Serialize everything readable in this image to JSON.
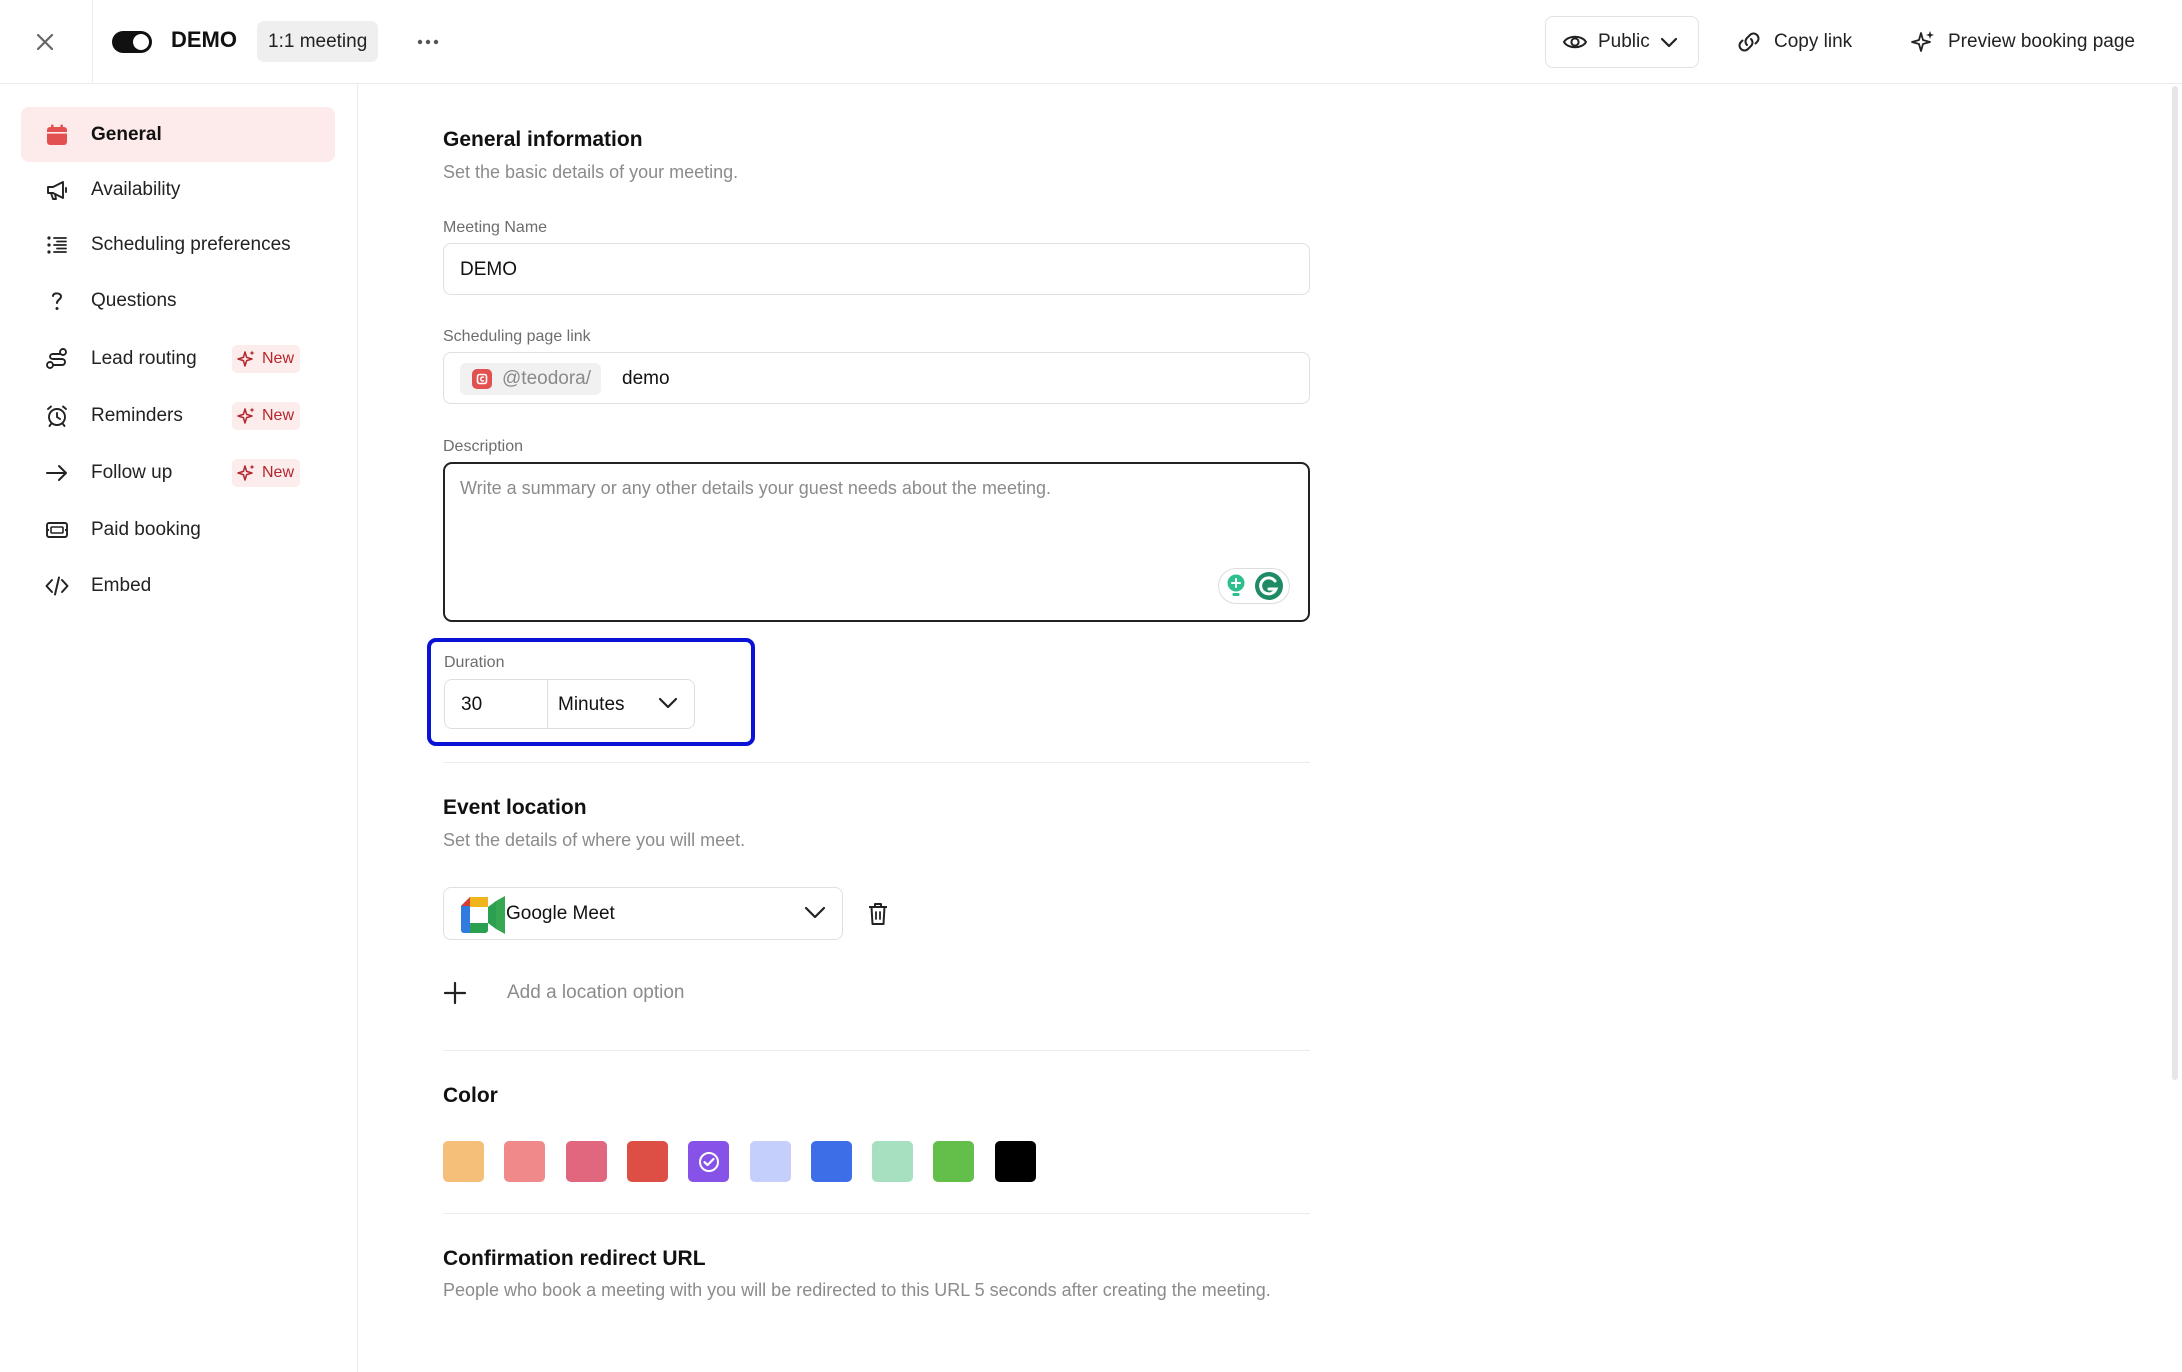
{
  "header": {
    "title": "DEMO",
    "meeting_type": "1:1 meeting",
    "visibility": "Public",
    "copy_link": "Copy link",
    "preview": "Preview booking page"
  },
  "sidebar": {
    "items": [
      {
        "label": "General",
        "icon": "calendar-icon",
        "active": true
      },
      {
        "label": "Availability",
        "icon": "megaphone-icon"
      },
      {
        "label": "Scheduling preferences",
        "icon": "list-icon"
      },
      {
        "label": "Questions",
        "icon": "question-icon"
      },
      {
        "label": "Lead routing",
        "icon": "route-icon",
        "badge": "New"
      },
      {
        "label": "Reminders",
        "icon": "alarm-clock-icon",
        "badge": "New"
      },
      {
        "label": "Follow up",
        "icon": "arrow-right-icon",
        "badge": "New"
      },
      {
        "label": "Paid booking",
        "icon": "ticket-icon"
      },
      {
        "label": "Embed",
        "icon": "code-icon"
      }
    ]
  },
  "general": {
    "title": "General information",
    "subtitle": "Set the basic details of your meeting.",
    "name_label": "Meeting Name",
    "name_value": "DEMO",
    "link_label": "Scheduling page link",
    "link_prefix": "@teodora/",
    "link_slug": "demo",
    "description_label": "Description",
    "description_placeholder": "Write a summary or any other details your guest needs about the meeting.",
    "duration_label": "Duration",
    "duration_value": "30",
    "duration_unit": "Minutes"
  },
  "location": {
    "title": "Event location",
    "subtitle": "Set the details of where you will meet.",
    "selected": "Google Meet",
    "add_option": "Add a location option"
  },
  "color": {
    "title": "Color",
    "swatches": [
      "#f5bf7a",
      "#f08a8a",
      "#e0677e",
      "#dd4f45",
      "#8752e8",
      "#c4cffb",
      "#3e6de8",
      "#a7dfc1",
      "#63bf4a",
      "#000000"
    ],
    "selected_index": 4
  },
  "redirect": {
    "title": "Confirmation redirect URL",
    "subtitle": "People who book a meeting with you will be redirected to this URL 5 seconds after creating the meeting."
  }
}
